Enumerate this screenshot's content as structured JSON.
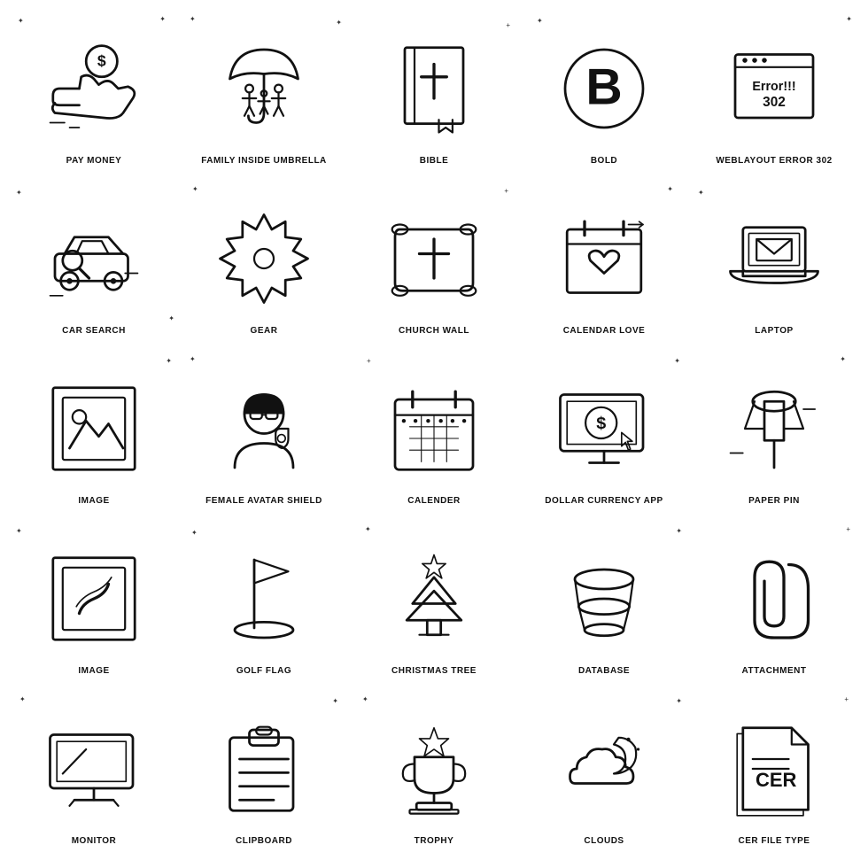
{
  "icons": [
    {
      "id": "pay-money",
      "label": "PAY MONEY"
    },
    {
      "id": "family-inside-umbrella",
      "label": "FAMILY INSIDE UMBRELLA"
    },
    {
      "id": "bible",
      "label": "BIBLE"
    },
    {
      "id": "bold",
      "label": "BOLD"
    },
    {
      "id": "weblayout-error-302",
      "label": "WEBLAYOUT ERROR 302"
    },
    {
      "id": "car-search",
      "label": "CAR SEARCH"
    },
    {
      "id": "gear",
      "label": "GEAR"
    },
    {
      "id": "church-wall",
      "label": "CHURCH WALL"
    },
    {
      "id": "calendar-love",
      "label": "CALENDAR LOVE"
    },
    {
      "id": "laptop",
      "label": "LAPTOP"
    },
    {
      "id": "image",
      "label": "IMAGE"
    },
    {
      "id": "female-avatar-shield",
      "label": "FEMALE AVATAR SHIELD"
    },
    {
      "id": "calender",
      "label": "CALENDER"
    },
    {
      "id": "dollar-currency-app",
      "label": "DOLLAR CURRENCY APP"
    },
    {
      "id": "paper-pin",
      "label": "PAPER PIN"
    },
    {
      "id": "image2",
      "label": "IMAGE"
    },
    {
      "id": "golf-flag",
      "label": "GOLF FLAG"
    },
    {
      "id": "christmas-tree",
      "label": "CHRISTMAS TREE"
    },
    {
      "id": "database",
      "label": "DATABASE"
    },
    {
      "id": "attachment",
      "label": "ATTACHMENT"
    },
    {
      "id": "monitor",
      "label": "MONITOR"
    },
    {
      "id": "clipboard",
      "label": "CLIPBOARD"
    },
    {
      "id": "trophy",
      "label": "TROPHY"
    },
    {
      "id": "clouds",
      "label": "CLOUDS"
    },
    {
      "id": "cer-file-type",
      "label": "CER FILE TYPE"
    }
  ]
}
